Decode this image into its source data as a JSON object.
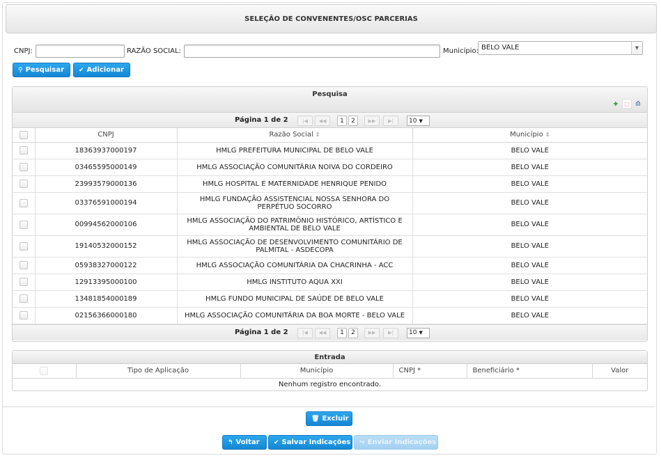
{
  "header": {
    "title": "SELEÇÃO DE CONVENENTES/OSC PARCERIAS"
  },
  "filters": {
    "cnpj_label": "CNPJ:",
    "cnpj_value": "",
    "razao_label": "RAZÃO SOCIAL:",
    "razao_value": "",
    "municipio_label": "Município:",
    "municipio_value": "BELO VALE",
    "search_button": "Pesquisar",
    "add_button": "Adicionar"
  },
  "search_panel": {
    "title": "Pesquisa",
    "page_text": "Página 1 de 2",
    "pages": [
      "1",
      "2"
    ],
    "rows_per_page": "10",
    "columns": [
      "CNPJ",
      "Razão Social",
      "Município"
    ],
    "rows": [
      {
        "cnpj": "18363937000197",
        "razao": "HMLG PREFEITURA MUNICIPAL DE BELO VALE",
        "municipio": "BELO VALE"
      },
      {
        "cnpj": "03465595000149",
        "razao": "HMLG ASSOCIAÇÃO COMUNITÁRIA NOIVA DO CORDEIRO",
        "municipio": "BELO VALE"
      },
      {
        "cnpj": "23993579000136",
        "razao": "HMLG HOSPITAL E MATERNIDADE HENRIQUE PENIDO",
        "municipio": "BELO VALE"
      },
      {
        "cnpj": "03376591000194",
        "razao": "HMLG FUNDAÇÃO ASSISTENCIAL NOSSA SENHORA DO PERPÉTUO SOCORRO",
        "municipio": "BELO VALE"
      },
      {
        "cnpj": "00994562000106",
        "razao": "HMLG ASSOCIAÇÃO DO PATRIMÔNIO HISTÓRICO, ARTÍSTICO E AMBIENTAL DE BELO VALE",
        "municipio": "BELO VALE"
      },
      {
        "cnpj": "19140532000152",
        "razao": "HMLG ASSOCIAÇÃO DE DESENVOLVIMENTO COMUNITÁRIO DE PALMITAL - ASDECOPA",
        "municipio": "BELO VALE"
      },
      {
        "cnpj": "05938327000122",
        "razao": "HMLG ASSOCIAÇÃO COMUNITÁRIA DA CHACRINHA - ACC",
        "municipio": "BELO VALE"
      },
      {
        "cnpj": "12913395000100",
        "razao": "HMLG INSTITUTO AQUA XXI",
        "municipio": "BELO VALE"
      },
      {
        "cnpj": "13481854000189",
        "razao": "HMLG FUNDO MUNICIPAL DE SAÚDE DE BELO VALE",
        "municipio": "BELO VALE"
      },
      {
        "cnpj": "02156366000180",
        "razao": "HMLG ASSOCIAÇÃO COMUNITÁRIA DA BOA MORTE - BELO VALE",
        "municipio": "BELO VALE"
      }
    ],
    "export_icons": [
      "excel-icon",
      "pdf-icon",
      "print-icon"
    ]
  },
  "entrada_panel": {
    "title": "Entrada",
    "columns": [
      "Tipo de Aplicação",
      "Município",
      "CNPJ *",
      "Beneficiário *",
      "Valor"
    ],
    "empty_message": "Nenhum registro encontrado."
  },
  "actions": {
    "excluir": "Excluir",
    "voltar": "Voltar",
    "salvar": "Salvar Indicações",
    "enviar": "Enviar Indicações"
  },
  "colors": {
    "button": "#1a8ede",
    "button_disabled": "#a9d4f2"
  }
}
